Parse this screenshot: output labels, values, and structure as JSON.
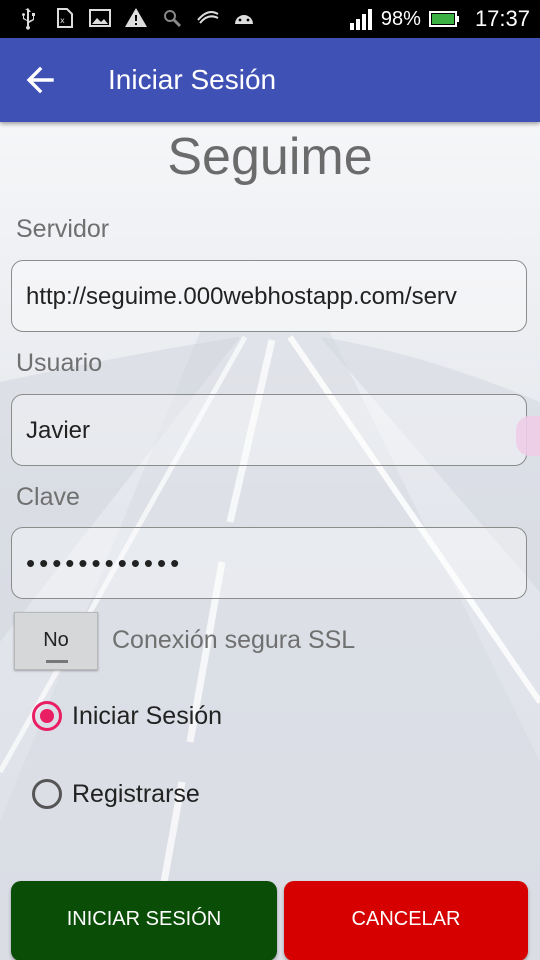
{
  "status_bar": {
    "battery_percent": "98%",
    "time": "17:37",
    "icons": [
      "usb-icon",
      "no-sim-icon",
      "image-icon",
      "warning-icon",
      "search-icon",
      "swipe-icon",
      "android-icon"
    ]
  },
  "app_bar": {
    "title": "Iniciar Sesión",
    "back_icon": "arrow-left-icon",
    "color": "#3f51b5"
  },
  "form": {
    "brand": "Seguime",
    "server_label": "Servidor",
    "server_value": "http://seguime.000webhostapp.com/serv",
    "user_label": "Usuario",
    "user_value": "Javier",
    "password_label": "Clave",
    "password_value": "••••••••••••",
    "ssl_toggle_text": "No",
    "ssl_label": "Conexión segura SSL",
    "options": [
      {
        "label": "Iniciar Sesión",
        "selected": true
      },
      {
        "label": "Registrarse",
        "selected": false
      }
    ]
  },
  "buttons": {
    "login_label": "INICIAR SESIÓN",
    "cancel_label": "CANCELAR",
    "login_color": "#0a4d06",
    "cancel_color": "#d60000"
  }
}
